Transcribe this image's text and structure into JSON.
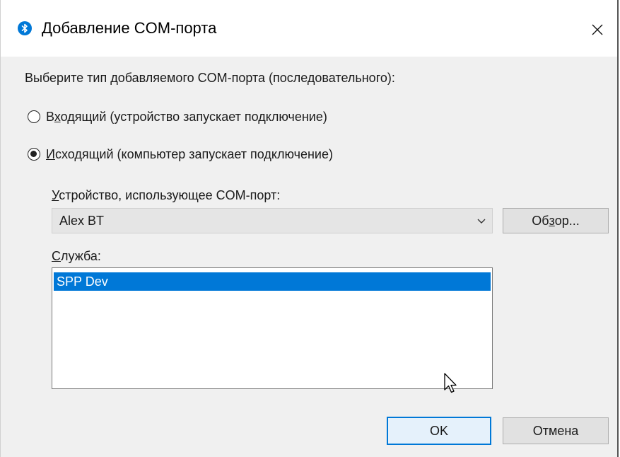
{
  "window": {
    "title": "Добавление COM-порта",
    "close_glyph": "✕"
  },
  "prompt": "Выберите тип добавляемого COM-порта (последовательного):",
  "radios": [
    {
      "prefix": "В",
      "accel": "х",
      "rest": "одящий (устройство запускает подключение)",
      "checked": false
    },
    {
      "prefix": "",
      "accel": "И",
      "rest": "сходящий (компьютер запускает подключение)",
      "checked": true
    }
  ],
  "device": {
    "label_accel": "У",
    "label_rest": "стройство, использующее COM-порт:",
    "value": "Alex BT"
  },
  "browse_button": {
    "before": "Об",
    "accel": "з",
    "after": "ор..."
  },
  "service": {
    "label_accel": "С",
    "label_rest": "лужба:",
    "items": [
      "SPP Dev"
    ],
    "selected_index": 0
  },
  "buttons": {
    "ok": "OK",
    "cancel": "Отмена"
  },
  "colors": {
    "accent": "#0078d7",
    "bluetooth": "#0078d7"
  },
  "icons": {
    "title": "bluetooth-icon",
    "close": "close-icon",
    "dropdown": "chevron-down-icon",
    "cursor": "mouse-pointer-icon"
  }
}
